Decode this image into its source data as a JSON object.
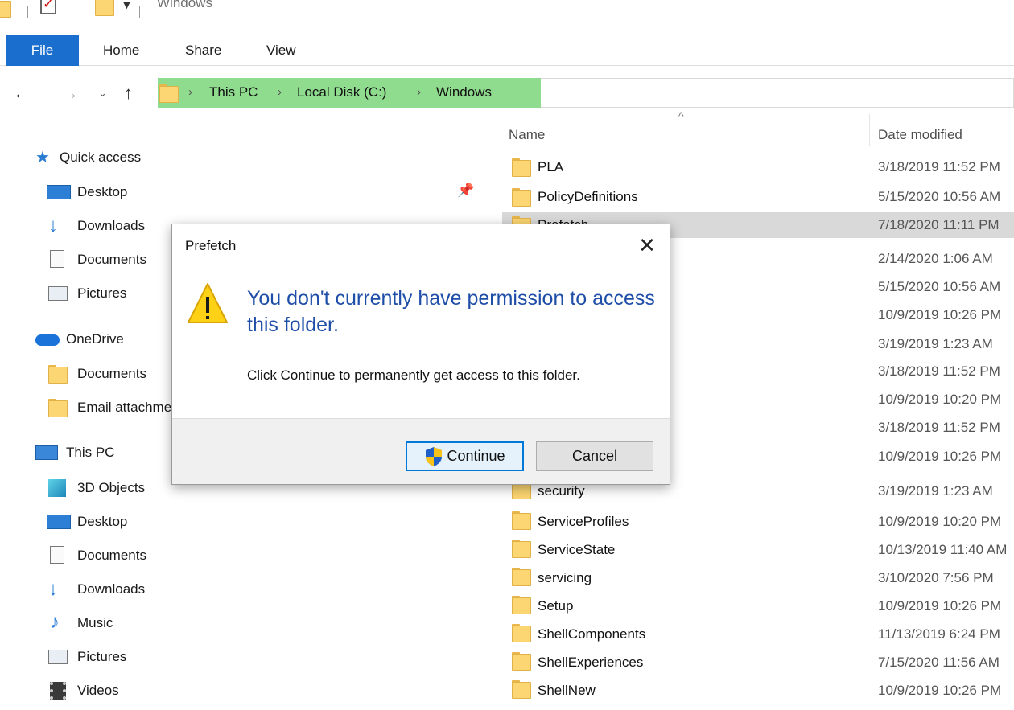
{
  "window": {
    "title": "Windows"
  },
  "ribbon": {
    "tabs": [
      "File",
      "Home",
      "Share",
      "View"
    ]
  },
  "address": {
    "crumbs": [
      "This PC",
      "Local Disk (C:)",
      "Windows"
    ]
  },
  "sidebar": {
    "quick_access": "Quick access",
    "quick_items": [
      "Desktop",
      "Downloads",
      "Documents",
      "Pictures"
    ],
    "onedrive": "OneDrive",
    "onedrive_items": [
      "Documents",
      "Email attachments"
    ],
    "this_pc": "This PC",
    "pc_items": [
      "3D Objects",
      "Desktop",
      "Documents",
      "Downloads",
      "Music",
      "Pictures",
      "Videos"
    ]
  },
  "columns": {
    "name": "Name",
    "date": "Date modified"
  },
  "files": [
    {
      "name": "PLA",
      "date": "3/18/2019 11:52 PM"
    },
    {
      "name": "PolicyDefinitions",
      "date": "5/15/2020 10:56 AM"
    },
    {
      "name": "Prefetch",
      "date": "7/18/2020 11:11 PM"
    },
    {
      "name": "",
      "date": "2/14/2020 1:06 AM"
    },
    {
      "name": "",
      "date": "5/15/2020 10:56 AM"
    },
    {
      "name": "",
      "date": "10/9/2019 10:26 PM"
    },
    {
      "name": "",
      "date": "3/19/2019 1:23 AM"
    },
    {
      "name": "",
      "date": "3/18/2019 11:52 PM"
    },
    {
      "name": "",
      "date": "10/9/2019 10:20 PM"
    },
    {
      "name": "",
      "date": "3/18/2019 11:52 PM"
    },
    {
      "name": "",
      "date": "10/9/2019 10:26 PM"
    },
    {
      "name": "security",
      "date": "3/19/2019 1:23 AM"
    },
    {
      "name": "ServiceProfiles",
      "date": "10/9/2019 10:20 PM"
    },
    {
      "name": "ServiceState",
      "date": "10/13/2019 11:40 AM"
    },
    {
      "name": "servicing",
      "date": "3/10/2020 7:56 PM"
    },
    {
      "name": "Setup",
      "date": "10/9/2019 10:26 PM"
    },
    {
      "name": "ShellComponents",
      "date": "11/13/2019 6:24 PM"
    },
    {
      "name": "ShellExperiences",
      "date": "7/15/2020 11:56 AM"
    },
    {
      "name": "ShellNew",
      "date": "10/9/2019 10:26 PM"
    }
  ],
  "dialog": {
    "title": "Prefetch",
    "main_message": "You don't currently have permission to access this folder.",
    "sub_message": "Click Continue to permanently get access to this folder.",
    "continue_label": "Continue",
    "cancel_label": "Cancel"
  }
}
